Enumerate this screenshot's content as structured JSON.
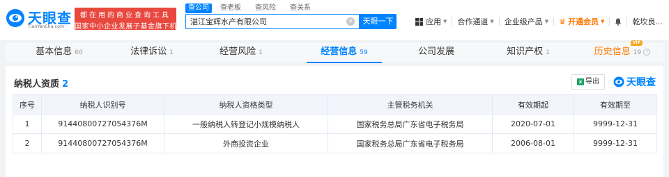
{
  "header": {
    "logo_text": "天眼查",
    "logo_domain": "TianYanCha.com",
    "slogan_line1": "都在用的商业查询工具",
    "slogan_line2": "国家中小企业发展子基金旗下机构",
    "search_tabs": [
      "查公司",
      "查老板",
      "查风险",
      "查关系"
    ],
    "search_value": "湛江宝辉水产有限公司",
    "search_button": "天眼一下",
    "nav": {
      "apps": "应用",
      "partners": "合作通道",
      "enterprise": "企业级产品",
      "vip": "开通会员",
      "user": "乾坎良..."
    }
  },
  "tabs": [
    {
      "label": "基本信息",
      "count": "60"
    },
    {
      "label": "法律诉讼",
      "count": "1"
    },
    {
      "label": "经营风险",
      "count": "1"
    },
    {
      "label": "经营信息",
      "count": "59"
    },
    {
      "label": "公司发展",
      "count": ""
    },
    {
      "label": "知识产权",
      "count": "1"
    },
    {
      "label": "历史信息",
      "count": "19"
    }
  ],
  "vip_badge": "VIP",
  "section": {
    "title": "纳税人资质",
    "count": "2",
    "export_label": "导出",
    "brand": "天眼查"
  },
  "table": {
    "columns": [
      "序号",
      "纳税人识别号",
      "纳税人资格类型",
      "主管税务机关",
      "有效期起",
      "有效期至"
    ],
    "rows": [
      [
        "1",
        "91440800727054376M",
        "一般纳税人转登记小规模纳税人",
        "国家税务总局广东省电子税务局",
        "2020-07-01",
        "9999-12-31"
      ],
      [
        "2",
        "91440800727054376M",
        "外商投资企业",
        "国家税务总局广东省电子税务局",
        "2006-08-01",
        "9999-12-31"
      ]
    ]
  },
  "colors": {
    "brand_blue": "#0084ff",
    "slogan_red": "#e8483e",
    "vip_orange": "#ff7700"
  }
}
